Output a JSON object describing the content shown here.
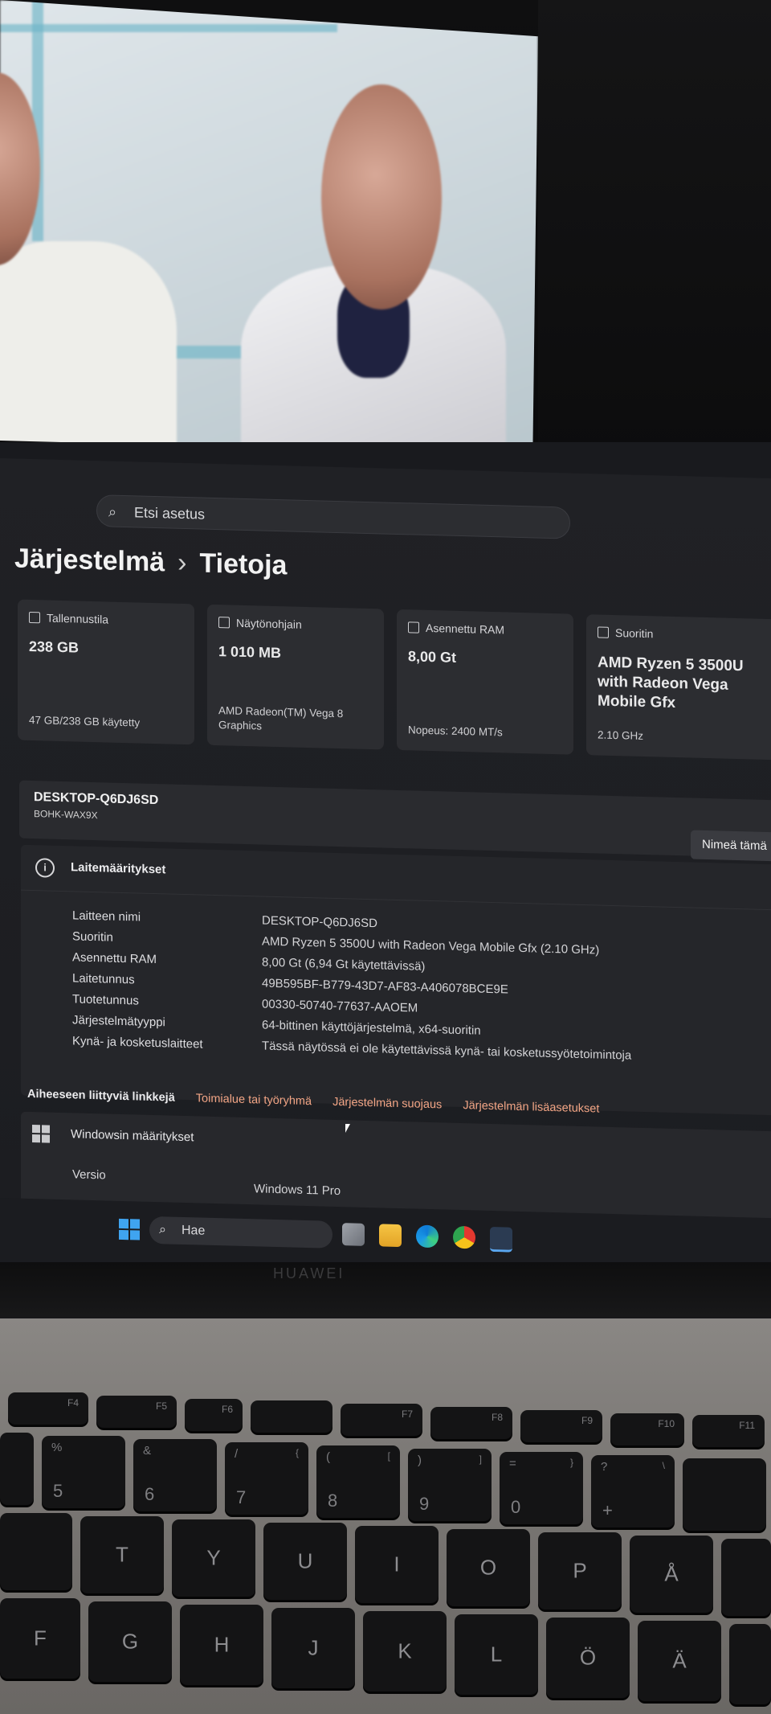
{
  "search": {
    "placeholder": "Etsi asetus"
  },
  "breadcrumb": {
    "parent": "Järjestelmä",
    "separator": "›",
    "current": "Tietoja"
  },
  "cards": [
    {
      "label": "Tallennustila",
      "value": "238 GB",
      "sub": "47 GB/238 GB käytetty"
    },
    {
      "label": "Näytönohjain",
      "value": "1 010 MB",
      "sub": "AMD Radeon(TM) Vega 8 Graphics"
    },
    {
      "label": "Asennettu RAM",
      "value": "8,00 Gt",
      "sub": "Nopeus: 2400 MT/s"
    },
    {
      "label": "Suoritin",
      "value": "AMD Ryzen 5 3500U with Radeon Vega Mobile Gfx",
      "sub": "2.10 GHz"
    }
  ],
  "device": {
    "name": "DESKTOP-Q6DJ6SD",
    "model": "BOHK-WAX9X",
    "rename_label": "Nimeä tämä"
  },
  "specs": {
    "title": "Laitemääritykset",
    "rows": [
      {
        "key": "Laitteen nimi",
        "value": "DESKTOP-Q6DJ6SD"
      },
      {
        "key": "Suoritin",
        "value": "AMD Ryzen 5 3500U with Radeon Vega Mobile Gfx   (2.10 GHz)"
      },
      {
        "key": "Asennettu RAM",
        "value": "8,00 Gt (6,94 Gt käytettävissä)"
      },
      {
        "key": "Laitetunnus",
        "value": "49B595BF-B779-43D7-AF83-A406078BCE9E"
      },
      {
        "key": "Tuotetunnus",
        "value": "00330-50740-77637-AAOEM"
      },
      {
        "key": "Järjestelmätyyppi",
        "value": "64-bittinen käyttöjärjestelmä, x64-suoritin"
      },
      {
        "key": "Kynä- ja kosketuslaitteet",
        "value": "Tässä näytössä ei ole käytettävissä kynä- tai kosketussyötetoimintoja"
      }
    ]
  },
  "related_links": {
    "heading": "Aiheeseen liittyviä linkkejä",
    "items": [
      "Toimialue tai työryhmä",
      "Järjestelmän suojaus",
      "Järjestelmän lisäasetukset"
    ]
  },
  "windows_specs": {
    "title": "Windowsin määritykset",
    "version_key": "Versio",
    "version_value": "Windows 11 Pro"
  },
  "taskbar": {
    "search_label": "Hae"
  },
  "laptop_brand": "HUAWEI",
  "keyboard": {
    "fn_row": [
      "F4",
      "F5",
      "F6",
      "F7",
      "F8",
      "F9",
      "F10",
      "F11"
    ],
    "num_row": [
      {
        "top": "%",
        "mid": "",
        "bot": "5"
      },
      {
        "top": "&",
        "mid": "",
        "bot": "6"
      },
      {
        "top": "/",
        "mid": "{",
        "bot": "7"
      },
      {
        "top": "(",
        "mid": "[",
        "bot": "8"
      },
      {
        "top": ")",
        "mid": "]",
        "bot": "9"
      },
      {
        "top": "=",
        "mid": "}",
        "bot": "0"
      },
      {
        "top": "?",
        "mid": "\\",
        "bot": "+"
      }
    ],
    "letter_row1": [
      "T",
      "Y",
      "U",
      "I",
      "O",
      "P",
      "Å"
    ],
    "letter_row2": [
      "F",
      "G",
      "H",
      "J",
      "K",
      "L",
      "Ö",
      "Ä"
    ]
  },
  "colors": {
    "accent_link": "#f2a585",
    "card_bg": "#2c2d31",
    "window_bg": "#202125"
  }
}
